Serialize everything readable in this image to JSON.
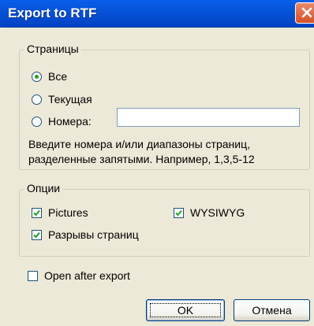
{
  "window": {
    "title": "Export to RTF",
    "close_icon": "close-icon"
  },
  "pages_group": {
    "legend": "Страницы",
    "options": [
      {
        "label": "Все",
        "checked": true
      },
      {
        "label": "Текущая",
        "checked": false
      },
      {
        "label": "Номера:",
        "checked": false
      }
    ],
    "page_numbers_value": "",
    "hint_line1": "Введите номера и/или диапазоны страниц,",
    "hint_line2": "разделенные запятыми. Например, 1,3,5-12"
  },
  "options_group": {
    "legend": "Опции",
    "pictures": {
      "label": "Pictures",
      "checked": true
    },
    "wysiwyg": {
      "label": "WYSIWYG",
      "checked": true
    },
    "page_breaks": {
      "label": "Разрывы страниц",
      "checked": true
    }
  },
  "open_after_export": {
    "label": "Open after export",
    "checked": false
  },
  "buttons": {
    "ok": "OK",
    "cancel": "Отмена"
  },
  "colors": {
    "titlebar": "#0552D7",
    "close": "#D6502A",
    "face": "#ECE9D8",
    "check": "#21A121"
  }
}
